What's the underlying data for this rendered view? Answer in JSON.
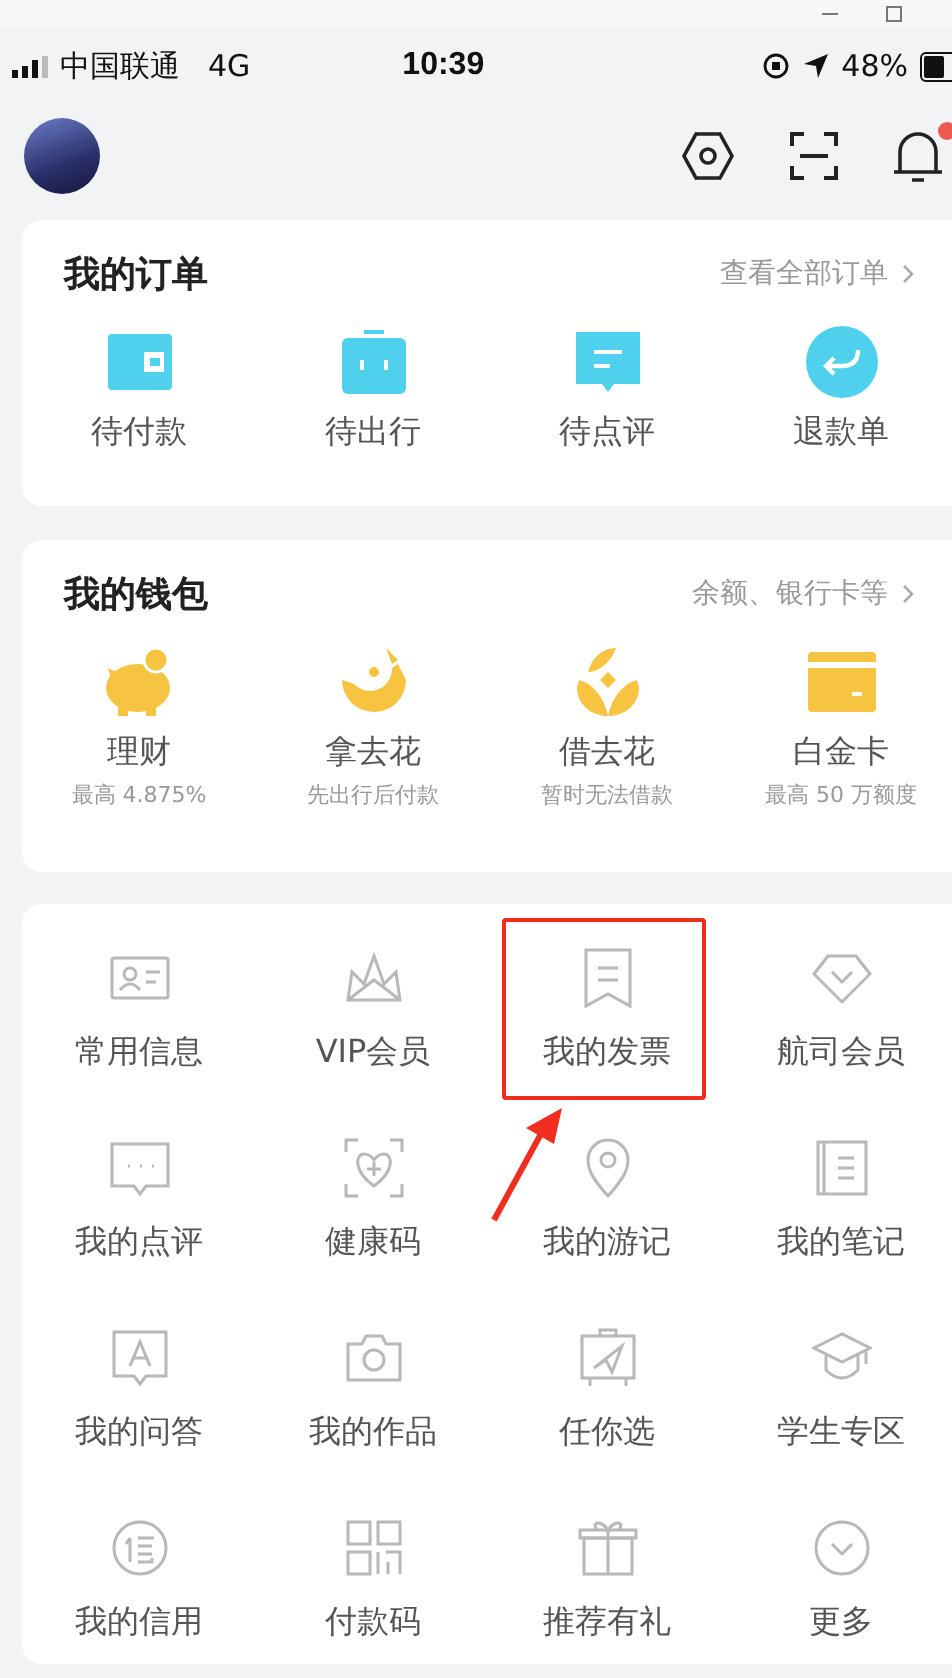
{
  "status_bar": {
    "carrier": "中国联通",
    "network": "4G",
    "time": "10:39",
    "battery": "48%"
  },
  "header": {
    "notification": true
  },
  "orders": {
    "title": "我的订单",
    "link": "查看全部订单",
    "items": [
      {
        "label": "待付款"
      },
      {
        "label": "待出行"
      },
      {
        "label": "待点评"
      },
      {
        "label": "退款单"
      }
    ]
  },
  "wallet": {
    "title": "我的钱包",
    "link": "余额、银行卡等",
    "items": [
      {
        "label": "理财",
        "sub": "最高 4.875%"
      },
      {
        "label": "拿去花",
        "sub": "先出行后付款"
      },
      {
        "label": "借去花",
        "sub": "暂时无法借款"
      },
      {
        "label": "白金卡",
        "sub": "最高 50 万额度"
      }
    ]
  },
  "services": {
    "items": [
      {
        "label": "常用信息",
        "annotated": false
      },
      {
        "label": "VIP会员",
        "annotated": false
      },
      {
        "label": "我的发票",
        "annotated": true
      },
      {
        "label": "航司会员",
        "annotated": false
      },
      {
        "label": "我的点评",
        "annotated": false
      },
      {
        "label": "健康码",
        "annotated": false
      },
      {
        "label": "我的游记",
        "annotated": false
      },
      {
        "label": "我的笔记",
        "annotated": false
      },
      {
        "label": "我的问答",
        "annotated": false
      },
      {
        "label": "我的作品",
        "annotated": false
      },
      {
        "label": "任你选",
        "annotated": false
      },
      {
        "label": "学生专区",
        "annotated": false
      },
      {
        "label": "我的信用",
        "annotated": false
      },
      {
        "label": "付款码",
        "annotated": false
      },
      {
        "label": "推荐有礼",
        "annotated": false
      },
      {
        "label": "更多",
        "annotated": false
      }
    ]
  }
}
